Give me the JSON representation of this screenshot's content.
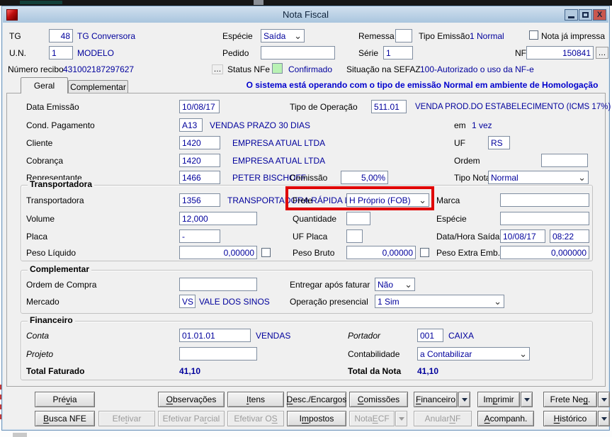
{
  "window": {
    "title": "Nota Fiscal"
  },
  "header": {
    "tg": {
      "label": "TG",
      "value": "48",
      "desc": "TG Conversora"
    },
    "especie": {
      "label": "Espécie",
      "value": "Saída"
    },
    "remessa": {
      "label": "Remessa",
      "value": ""
    },
    "tipo_emissao": {
      "label": "Tipo Emissão",
      "value": "1 Normal"
    },
    "nota_impressa": {
      "label": "Nota já impressa",
      "checked": false
    },
    "un": {
      "label": "U.N.",
      "value": "1",
      "desc": "MODELO"
    },
    "pedido": {
      "label": "Pedido",
      "value": ""
    },
    "serie": {
      "label": "Série",
      "value": "1"
    },
    "nf": {
      "label": "NF",
      "value": "150841",
      "more": "…"
    },
    "recibo": {
      "label": "Número recibo",
      "value": "431002187297627",
      "more": "…"
    },
    "status_nfe": {
      "label": "Status NFe",
      "value": "Confirmado"
    },
    "sefaz": {
      "label": "Situação na SEFAZ",
      "value": "100-Autorizado o uso da NF-e"
    }
  },
  "tabs": {
    "geral": "Geral",
    "complementar": "Complementar",
    "notice": "O sistema está operando com o tipo de emissão Normal em ambiente de Homologação"
  },
  "geral": {
    "data_emissao": {
      "label": "Data Emissão",
      "value": "10/08/17"
    },
    "tipo_operacao": {
      "label": "Tipo de Operação",
      "code": "511.01",
      "desc": "VENDA PROD.DO ESTABELECIMENTO (ICMS 17%)"
    },
    "cond_pagamento": {
      "label": "Cond. Pagamento",
      "code": "A13",
      "desc": "VENDAS PRAZO 30 DIAS"
    },
    "em": {
      "label": "em",
      "value": "1 vez"
    },
    "cliente": {
      "label": "Cliente",
      "code": "1420",
      "desc": "EMPRESA ATUAL LTDA"
    },
    "uf": {
      "label": "UF",
      "value": "RS"
    },
    "cobranca": {
      "label": "Cobrança",
      "code": "1420",
      "desc": "EMPRESA ATUAL LTDA"
    },
    "ordem": {
      "label": "Ordem",
      "value": ""
    },
    "representante": {
      "label": "Representante",
      "code": "1466",
      "desc": "PETER BISCHOFF"
    },
    "comissao": {
      "label": "Comissão",
      "value": "5,00%"
    },
    "tipo_nota": {
      "label": "Tipo Nota",
      "value": "Normal"
    }
  },
  "transportadora": {
    "title": "Transportadora",
    "transportadora": {
      "label": "Transportadora",
      "code": "1356",
      "desc": "TRANSPORTADORA RÁPIDA LTDA"
    },
    "frete": {
      "label": "Frete",
      "value": "H Próprio (FOB)"
    },
    "marca": {
      "label": "Marca",
      "value": ""
    },
    "volume": {
      "label": "Volume",
      "value": "12,000"
    },
    "quantidade": {
      "label": "Quantidade",
      "value": ""
    },
    "especie": {
      "label": "Espécie",
      "value": ""
    },
    "placa": {
      "label": "Placa",
      "value": "-"
    },
    "uf_placa": {
      "label": "UF Placa",
      "value": ""
    },
    "data_saida": {
      "label": "Data/Hora Saída",
      "date": "10/08/17",
      "time": "08:22"
    },
    "peso_liquido": {
      "label": "Peso Líquido",
      "value": "0,00000"
    },
    "peso_bruto": {
      "label": "Peso Bruto",
      "value": "0,00000"
    },
    "peso_extra": {
      "label": "Peso Extra Emb.",
      "value": "0,000000"
    }
  },
  "complementar": {
    "title": "Complementar",
    "ordem_compra": {
      "label": "Ordem de Compra",
      "value": ""
    },
    "entregar": {
      "label": "Entregar após faturar",
      "value": "Não"
    },
    "mercado": {
      "label": "Mercado",
      "code": "VS",
      "desc": "VALE DOS SINOS"
    },
    "operacao": {
      "label": "Operação presencial",
      "value": "1 Sim"
    }
  },
  "financeiro": {
    "title": "Financeiro",
    "conta": {
      "label": "Conta",
      "code": "01.01.01",
      "desc": "VENDAS"
    },
    "portador": {
      "label": "Portador",
      "code": "001",
      "desc": "CAIXA"
    },
    "projeto": {
      "label": "Projeto",
      "value": ""
    },
    "contabilidade": {
      "label": "Contabilidade",
      "value": "a Contabilizar"
    },
    "total_faturado": {
      "label": "Total Faturado",
      "value": "41,10"
    },
    "total_nota": {
      "label": "Total da Nota",
      "value": "41,10"
    }
  },
  "buttons": {
    "row1": [
      {
        "name": "previa",
        "label": "Prévia",
        "accel": 3,
        "enabled": true,
        "arrow": false
      },
      {
        "name": "observacoes",
        "label": "Observações",
        "accel": 0,
        "enabled": true,
        "arrow": false
      },
      {
        "name": "itens",
        "label": "Itens",
        "accel": 0,
        "enabled": true,
        "arrow": false
      },
      {
        "name": "desc-encargos",
        "label": "Desc./Encargos",
        "accel": 0,
        "enabled": true,
        "arrow": false
      },
      {
        "name": "comissoes",
        "label": "Comissões",
        "accel": 0,
        "enabled": true,
        "arrow": false
      },
      {
        "name": "financeiro",
        "label": "Financeiro",
        "accel": 0,
        "enabled": true,
        "arrow": true
      },
      {
        "name": "imprimir",
        "label": "Imprimir",
        "accel": 2,
        "enabled": true,
        "arrow": true
      },
      {
        "name": "frete-neg",
        "label": "Frete Neg.",
        "accel": 8,
        "enabled": true,
        "arrow": true
      }
    ],
    "row2": [
      {
        "name": "busca-nfe",
        "label": "Busca NFE",
        "accel": 0,
        "enabled": true,
        "arrow": false
      },
      {
        "name": "efetivar",
        "label": "Efetivar",
        "accel": 3,
        "enabled": false,
        "arrow": false
      },
      {
        "name": "efetivar-parcial",
        "label": "Efetivar Parcial",
        "accel": 11,
        "enabled": false,
        "arrow": false
      },
      {
        "name": "efetivar-os",
        "label": "Efetivar OS",
        "accel": 10,
        "enabled": false,
        "arrow": false
      },
      {
        "name": "impostos",
        "label": "Impostos",
        "accel": 1,
        "enabled": true,
        "arrow": false
      },
      {
        "name": "nota-ecf",
        "label": "Nota ECF",
        "accel": 5,
        "enabled": false,
        "arrow": true
      },
      {
        "name": "anular-nf",
        "label": "Anular NF",
        "accel": 7,
        "enabled": false,
        "arrow": false
      },
      {
        "name": "acompanh",
        "label": "Acompanh.",
        "accel": 0,
        "enabled": true,
        "arrow": false
      },
      {
        "name": "historico",
        "label": "Histórico",
        "accel": 0,
        "enabled": true,
        "arrow": true
      }
    ]
  },
  "colors": {
    "value_text": "#00009c",
    "notice_text": "#0000cd",
    "highlight": "#e00000",
    "status_ok_bg": "#b9f2b4"
  }
}
